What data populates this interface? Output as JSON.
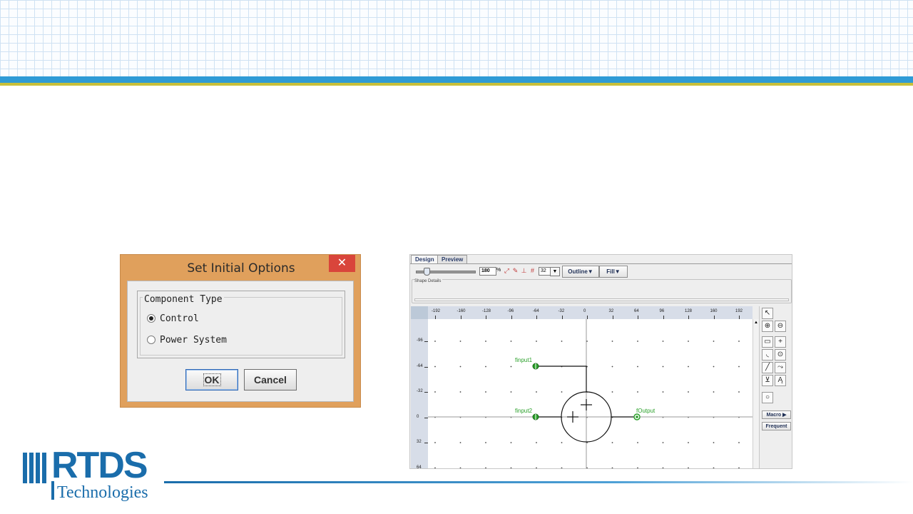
{
  "dialog": {
    "title": "Set Initial Options",
    "close_glyph": "✕",
    "group_label": "Component Type",
    "options": [
      {
        "label": "Control",
        "selected": true
      },
      {
        "label": "Power System",
        "selected": false
      }
    ],
    "ok_label": "OK",
    "cancel_label": "Cancel",
    "title_bar_color": "#e0a05c",
    "close_color": "#d9453b"
  },
  "editor": {
    "tabs": [
      "Design",
      "Preview"
    ],
    "active_tab": "Design",
    "zoom_value": "180",
    "zoom_unit": "%",
    "grid_value": "32",
    "outline_label": "Outline▼",
    "fill_label": "Fill▼",
    "details_label": "Shape Details",
    "ruler_x": [
      "-192",
      "-160",
      "-128",
      "-96",
      "-64",
      "-32",
      "0",
      "32",
      "64",
      "96",
      "128",
      "160",
      "192"
    ],
    "ruler_y": [
      "-96",
      "-64",
      "-32",
      "0",
      "32",
      "64"
    ],
    "ports": {
      "input1": "finput1",
      "input2": "finput2",
      "output": "fOutput"
    },
    "port_color": "#2aa02a",
    "macro_label": "Macro",
    "frequent_label": "Frequent"
  },
  "logo": {
    "name": "RTDS",
    "subtitle": "Technologies",
    "color": "#1a6dab"
  }
}
